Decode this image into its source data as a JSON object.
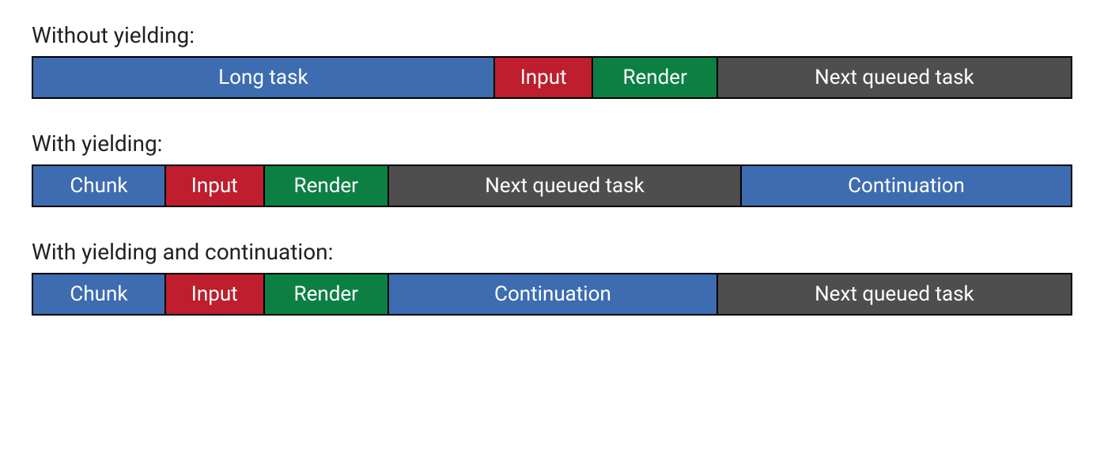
{
  "colors": {
    "blue": "#3d6cb0",
    "red": "#be1e2d",
    "green": "#0c8043",
    "gray": "#4e4e4e"
  },
  "rows": [
    {
      "title": "Without yielding:",
      "segments": [
        {
          "label": "Long task",
          "width": 44.5,
          "colorKey": "blue"
        },
        {
          "label": "Input",
          "width": 9.5,
          "colorKey": "red"
        },
        {
          "label": "Render",
          "width": 12.0,
          "colorKey": "green"
        },
        {
          "label": "Next queued task",
          "width": 34.0,
          "colorKey": "gray"
        }
      ]
    },
    {
      "title": "With yielding:",
      "segments": [
        {
          "label": "Chunk",
          "width": 12.8,
          "colorKey": "blue"
        },
        {
          "label": "Input",
          "width": 9.5,
          "colorKey": "red"
        },
        {
          "label": "Render",
          "width": 12.0,
          "colorKey": "green"
        },
        {
          "label": "Next queued task",
          "width": 34.0,
          "colorKey": "gray"
        },
        {
          "label": "Continuation",
          "width": 31.7,
          "colorKey": "blue"
        }
      ]
    },
    {
      "title": "With yielding and continuation:",
      "segments": [
        {
          "label": "Chunk",
          "width": 12.8,
          "colorKey": "blue"
        },
        {
          "label": "Input",
          "width": 9.5,
          "colorKey": "red"
        },
        {
          "label": "Render",
          "width": 12.0,
          "colorKey": "green"
        },
        {
          "label": "Continuation",
          "width": 31.7,
          "colorKey": "blue"
        },
        {
          "label": "Next queued task",
          "width": 34.0,
          "colorKey": "gray"
        }
      ]
    }
  ]
}
